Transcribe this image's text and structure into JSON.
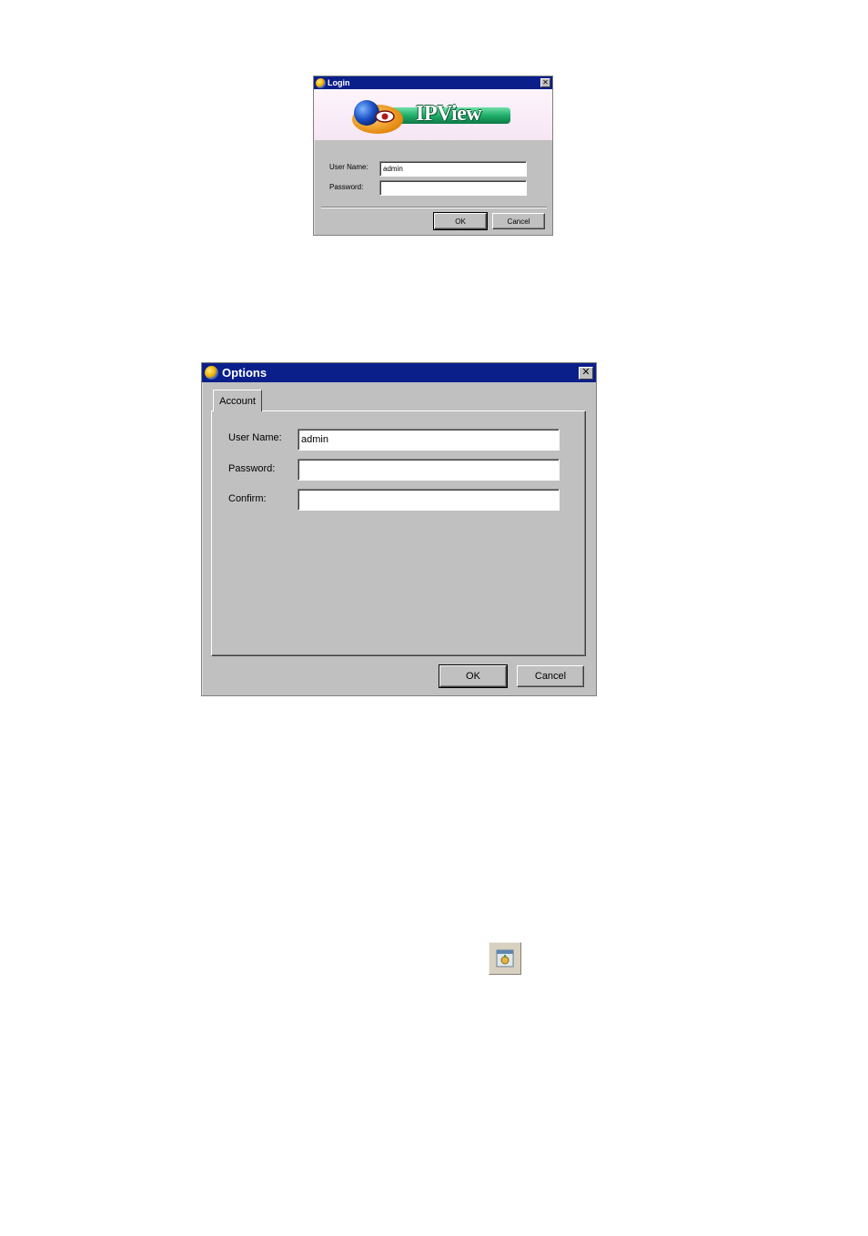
{
  "login": {
    "title": "Login",
    "logo_text": "IPView",
    "username_label": "User Name:",
    "username_value": "admin",
    "password_label": "Password:",
    "password_value": "",
    "ok_label": "OK",
    "cancel_label": "Cancel"
  },
  "options": {
    "title": "Options",
    "tab_label": "Account",
    "username_label": "User Name:",
    "username_value": "admin",
    "password_label": "Password:",
    "password_value": "",
    "confirm_label": "Confirm:",
    "confirm_value": "",
    "ok_label": "OK",
    "cancel_label": "Cancel"
  },
  "icons": {
    "close": "close-icon",
    "app": "ipview-app-icon",
    "toolbar": "toolbar-options-icon"
  },
  "colors": {
    "titlebar": "#0a1f8a",
    "dialog_face": "#c0c0c0"
  }
}
